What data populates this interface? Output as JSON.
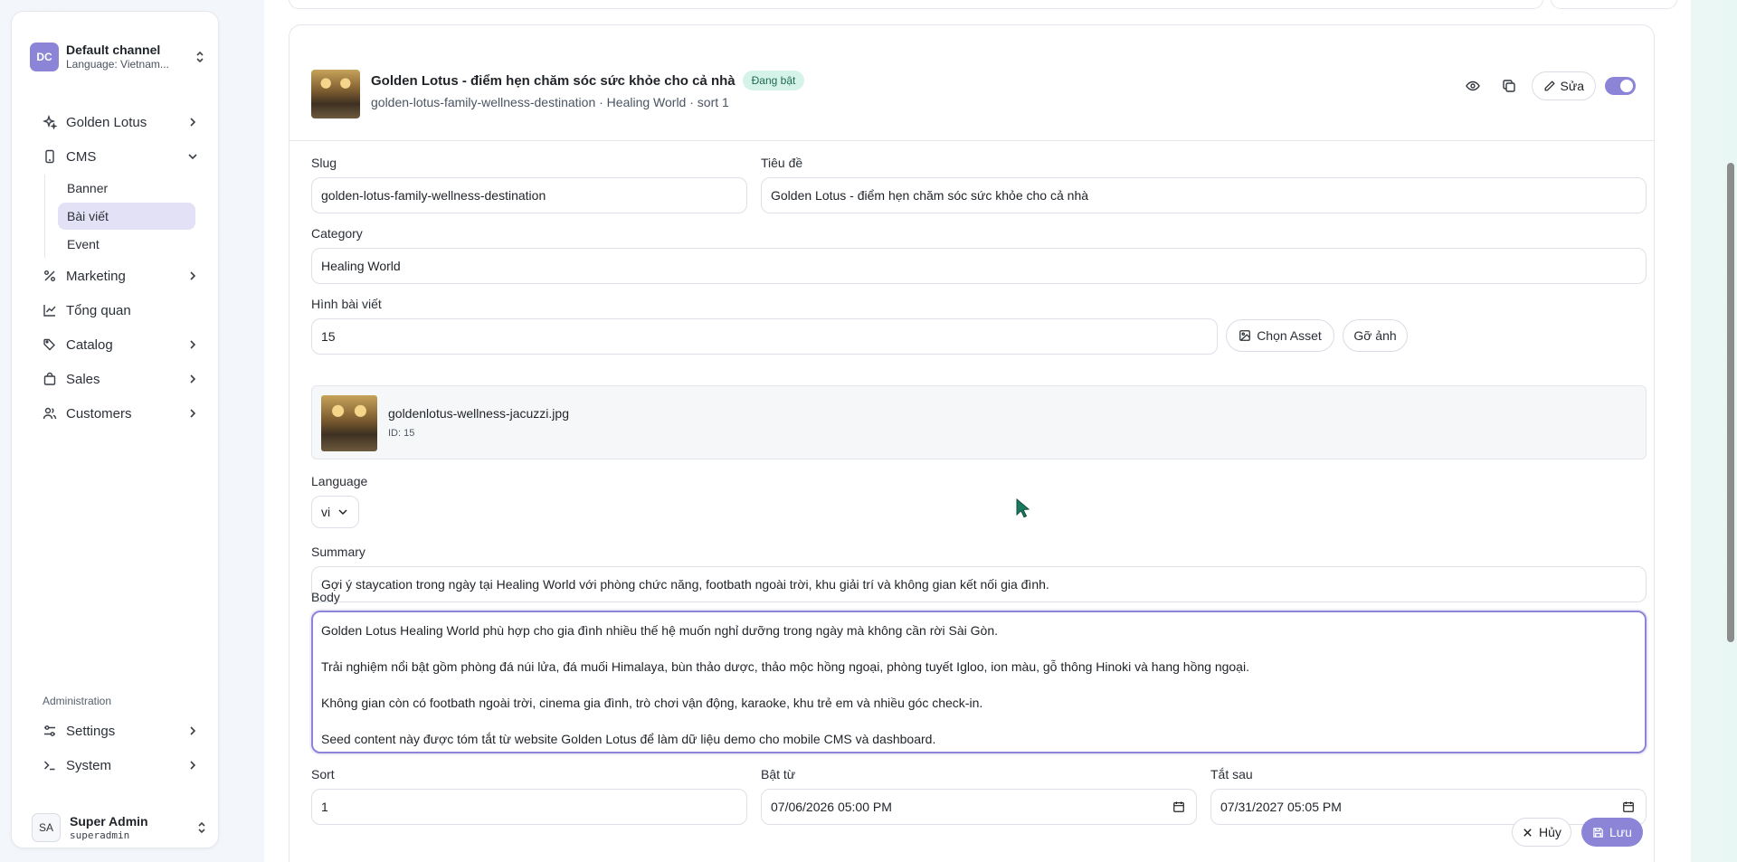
{
  "channel": {
    "initials": "DC",
    "title": "Default channel",
    "subtitle": "Language: Vietnam..."
  },
  "nav": {
    "golden_lotus": "Golden Lotus",
    "cms": "CMS",
    "cms_children": [
      "Banner",
      "Bài viết",
      "Event"
    ],
    "marketing": "Marketing",
    "overview": "Tổng quan",
    "catalog": "Catalog",
    "sales": "Sales",
    "customers": "Customers"
  },
  "admin": {
    "label": "Administration",
    "settings": "Settings",
    "system": "System"
  },
  "user": {
    "initials": "SA",
    "name": "Super Admin",
    "login": "superadmin"
  },
  "article": {
    "title": "Golden Lotus - điểm hẹn chăm sóc sức khỏe cho cả nhà",
    "status": "Đang bật",
    "meta": "golden-lotus-family-wellness-destination · Healing World · sort 1",
    "edit_label": "Sửa"
  },
  "form": {
    "slug_label": "Slug",
    "slug_value": "golden-lotus-family-wellness-destination",
    "title_label": "Tiêu đề",
    "title_value": "Golden Lotus - điểm hẹn chăm sóc sức khỏe cho cả nhà",
    "category_label": "Category",
    "category_value": "Healing World",
    "image_label": "Hình bài viết",
    "image_value": "15",
    "choose_asset": "Chọn Asset",
    "remove_image": "Gỡ ảnh",
    "asset_name": "goldenlotus-wellness-jacuzzi.jpg",
    "asset_id": "ID: 15",
    "language_label": "Language",
    "language_value": "vi",
    "summary_label": "Summary",
    "summary_value": "Gợi ý staycation trong ngày tại Healing World với phòng chức năng, footbath ngoài trời, khu giải trí và không gian kết nối gia đình.",
    "body_label": "Body",
    "body_lines": [
      "Golden Lotus Healing World phù hợp cho gia đình nhiều thế hệ muốn nghỉ dưỡng trong ngày mà không cần rời Sài Gòn.",
      "Trải nghiệm nổi bật gồm phòng đá núi lửa, đá muối Himalaya, bùn thảo dược, thảo mộc hồng ngoại, phòng tuyết Igloo, ion màu, gỗ thông Hinoki và hang hồng ngoại.",
      "Không gian còn có footbath ngoài trời, cinema gia đình, trò chơi vận động, karaoke, khu trẻ em và nhiều góc check-in.",
      "Seed content này được tóm tắt từ website Golden Lotus để làm dữ liệu demo cho mobile CMS và dashboard."
    ],
    "sort_label": "Sort",
    "sort_value": "1",
    "start_label": "Bật từ",
    "start_value": "07/06/2026 05:00 PM",
    "end_label": "Tắt sau",
    "end_value": "07/31/2027 05:05 PM",
    "cancel_label": "Hủy",
    "save_label": "Lưu"
  },
  "colors": {
    "accent": "#8b84d7",
    "badge_bg": "#d6f3ea",
    "active_nav_bg": "#e3e1f5"
  }
}
